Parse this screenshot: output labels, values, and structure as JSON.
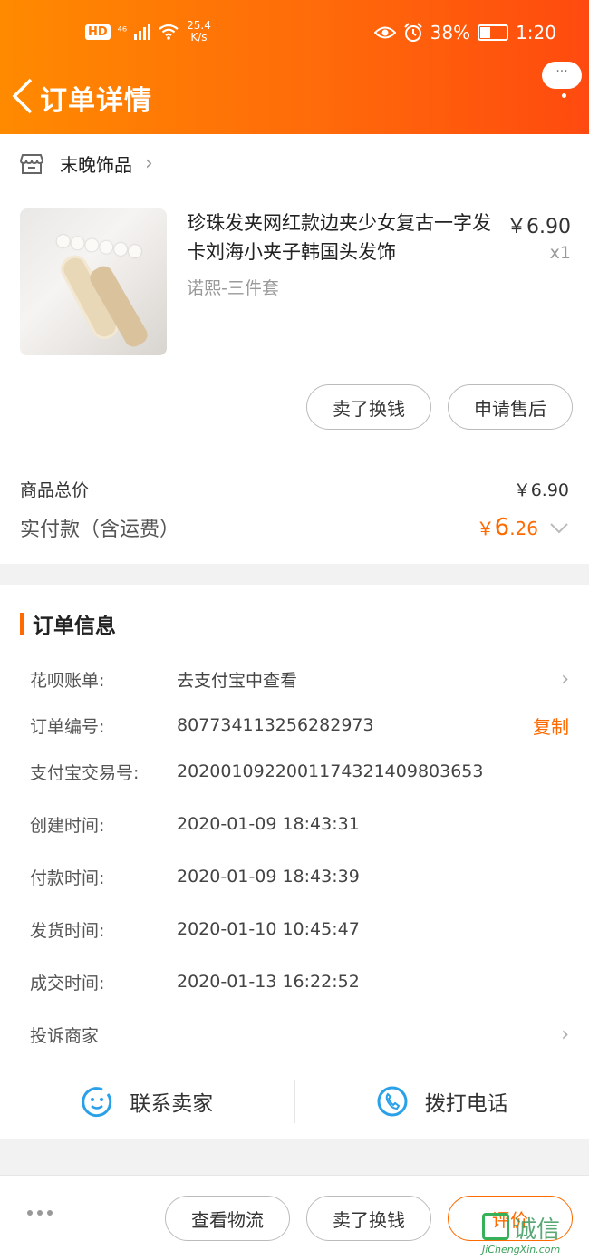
{
  "status_bar": {
    "hd": "HD",
    "signal": "⁴⁶",
    "net_speed_value": "25.4",
    "net_speed_unit": "K/s",
    "battery": "38%",
    "battery_level": 0.38,
    "time": "1:20"
  },
  "nav": {
    "title": "订单详情",
    "more_label": "···"
  },
  "shop": {
    "name": "末晚饰品"
  },
  "product": {
    "title": "珍珠发夹网红款边夹少女复古一字发卡刘海小夹子韩国头发饰",
    "sku": "诺熙-三件套",
    "price": "￥6.90",
    "qty": "x1",
    "buttons": [
      "卖了换钱",
      "申请售后"
    ]
  },
  "summary": {
    "total_label": "商品总价",
    "total_value": "￥6.90",
    "paid_label": "实付款（含运费）",
    "paid_yen": "￥",
    "paid_int": "6",
    "paid_dec": ".26"
  },
  "order_info": {
    "title": "订单信息",
    "rows": [
      {
        "label": "花呗账单:",
        "value": "去支付宝中查看"
      },
      {
        "label": "订单编号:",
        "value": "807734113256282973",
        "action": "复制"
      },
      {
        "label": "支付宝交易号:",
        "value": "2020010922001174321409803653"
      },
      {
        "label": "创建时间:",
        "value": "2020-01-09 18:43:31"
      },
      {
        "label": "付款时间:",
        "value": "2020-01-09 18:43:39"
      },
      {
        "label": "发货时间:",
        "value": "2020-01-10 10:45:47"
      },
      {
        "label": "成交时间:",
        "value": "2020-01-13 16:22:52"
      },
      {
        "label": "投诉商家",
        "value": ""
      }
    ],
    "contact_seller": "联系卖家",
    "call_phone": "拨打电话"
  },
  "bottom_bar": {
    "buttons": [
      "查看物流",
      "卖了换钱",
      "评价"
    ]
  },
  "watermark": {
    "cn": "诚信",
    "en": "JiChengXin.com"
  },
  "colors": {
    "accent": "#ff6a00",
    "header_start": "#ff8a00",
    "header_end": "#ff4a0f",
    "link_blue": "#2aa0e8"
  }
}
